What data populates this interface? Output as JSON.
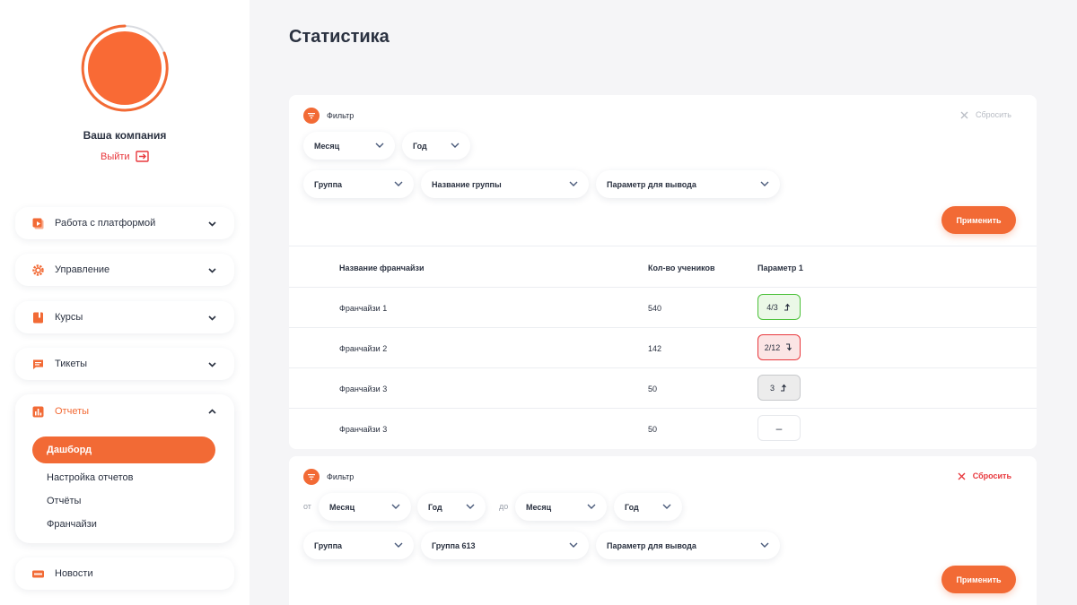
{
  "sidebar": {
    "company_name": "Ваша компания",
    "logout_label": "Выйти",
    "nav": [
      {
        "label": "Работа с платформой",
        "icon": "play-icon"
      },
      {
        "label": "Управление",
        "icon": "gear-icon"
      },
      {
        "label": "Курсы",
        "icon": "book-icon"
      },
      {
        "label": "Тикеты",
        "icon": "chat-icon"
      }
    ],
    "reports": {
      "label": "Отчеты",
      "icon": "bar-chart-icon",
      "subitems": [
        "Дашборд",
        "Настройка отчетов",
        "Отчёты",
        "Франчайзи"
      ]
    },
    "news": {
      "label": "Новости",
      "icon": "new-badge-icon"
    }
  },
  "page": {
    "title": "Статистика"
  },
  "filter1": {
    "title": "Фильтр",
    "reset_label": "Сбросить",
    "month": "Месяц",
    "year": "Год",
    "group": "Группа",
    "group_name": "Название группы",
    "param": "Параметр для вывода",
    "apply_label": "Применить"
  },
  "table": {
    "headers": [
      "Название франчайзи",
      "Кол-во учеников",
      "Параметр 1"
    ],
    "rows": [
      {
        "name": "Франчайзи 1",
        "count": "540",
        "param": "4/3",
        "trend": "up",
        "style": "green"
      },
      {
        "name": "Франчайзи 2",
        "count": "142",
        "param": "2/12",
        "trend": "down",
        "style": "red"
      },
      {
        "name": "Франчайзи 3",
        "count": "50",
        "param": "3",
        "trend": "up",
        "style": "grey"
      },
      {
        "name": "Франчайзи 3",
        "count": "50",
        "param": "–",
        "trend": "none",
        "style": "none"
      }
    ]
  },
  "filter2": {
    "title": "Фильтр",
    "reset_label": "Сбросить",
    "from_label": "от",
    "to_label": "до",
    "from_month": "Месяц",
    "from_year": "Год",
    "to_month": "Месяц",
    "to_year": "Год",
    "group": "Группа",
    "group_value": "Группа 613",
    "param": "Параметр для вывода",
    "apply_label": "Применить"
  },
  "colors": {
    "accent": "#f26a35",
    "danger": "#e8383d",
    "success": "#4cc13a",
    "background": "#f5f5f7"
  }
}
